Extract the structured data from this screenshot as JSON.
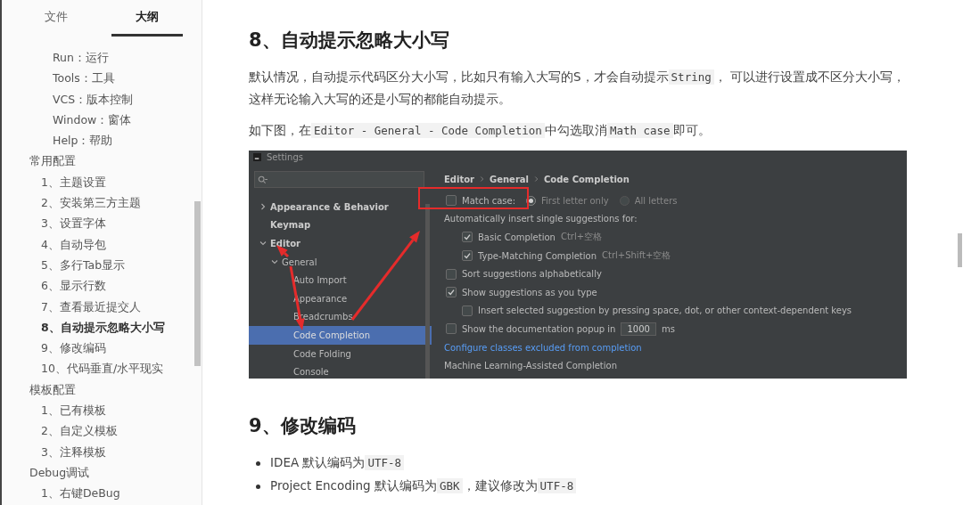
{
  "sidebar": {
    "tabs": [
      {
        "label": "文件",
        "selected": false
      },
      {
        "label": "大纲",
        "selected": true
      }
    ],
    "outline": [
      {
        "children": [
          {
            "children": [
              {
                "label": "Run：运行",
                "selected": false
              },
              {
                "label": "Tools：工具",
                "selected": false
              },
              {
                "label": "VCS：版本控制",
                "selected": false
              },
              {
                "label": "Window：窗体",
                "selected": false
              },
              {
                "label": "Help：帮助",
                "selected": false
              }
            ]
          }
        ]
      },
      {
        "label": "常用配置",
        "selected": false,
        "children": [
          {
            "label": "1、主题设置",
            "selected": false
          },
          {
            "label": "2、安装第三方主题",
            "selected": false
          },
          {
            "label": "3、设置字体",
            "selected": false
          },
          {
            "label": "4、自动导包",
            "selected": false
          },
          {
            "label": "5、多行Tab显示",
            "selected": false
          },
          {
            "label": "6、显示行数",
            "selected": false
          },
          {
            "label": "7、查看最近提交人",
            "selected": false
          },
          {
            "label": "8、自动提示忽略大小写",
            "selected": true
          },
          {
            "label": "9、修改编码",
            "selected": false
          },
          {
            "label": "10、代码垂直/水平现实",
            "selected": false
          }
        ]
      },
      {
        "label": "模板配置",
        "selected": false,
        "children": [
          {
            "label": "1、已有模板",
            "selected": false
          },
          {
            "label": "2、自定义模板",
            "selected": false
          },
          {
            "label": "3、注释模板",
            "selected": false
          }
        ]
      },
      {
        "label": "Debug调试",
        "selected": false,
        "children": [
          {
            "label": "1、右键DeBug",
            "selected": false
          }
        ]
      }
    ]
  },
  "article": [
    {
      "kind": "heading",
      "text": "8、自动提示忽略大小写"
    },
    {
      "kind": "paragraph",
      "segments": [
        {
          "kind": "text",
          "text": "默认情况，自动提示代码区分大小写，比如只有输入大写的S，才会自动提示"
        },
        {
          "kind": "code",
          "text": "String"
        },
        {
          "kind": "text",
          "text": "， 可以进行设置成不区分大小写，这样无论输入大写的还是小写的都能自动提示。"
        }
      ]
    },
    {
      "kind": "paragraph",
      "segments": [
        {
          "kind": "text",
          "text": "如下图，在"
        },
        {
          "kind": "code",
          "text": "Editor - General - Code Completion"
        },
        {
          "kind": "text",
          "text": "中勾选取消"
        },
        {
          "kind": "code",
          "text": "Math case"
        },
        {
          "kind": "text",
          "text": "即可。"
        }
      ]
    },
    {
      "kind": "screenshot",
      "title": "Settings",
      "tree": [
        {
          "label": "Appearance & Behavior",
          "expanded": false,
          "selected": false
        },
        {
          "label": "Keymap",
          "selected": false
        },
        {
          "label": "Editor",
          "expanded": true,
          "selected": false,
          "children": [
            {
              "label": "General",
              "expanded": true,
              "selected": false,
              "children": [
                {
                  "label": "Auto Import",
                  "selected": false
                },
                {
                  "label": "Appearance",
                  "selected": false
                },
                {
                  "label": "Breadcrumbs",
                  "selected": false
                },
                {
                  "label": "Code Completion",
                  "selected": true
                },
                {
                  "label": "Code Folding",
                  "selected": false
                },
                {
                  "label": "Console",
                  "selected": false
                }
              ]
            }
          ]
        }
      ],
      "breadcrumbs": [
        "Editor",
        "General",
        "Code Completion"
      ],
      "options": [
        {
          "kind": "checkbox",
          "label": "Match case:",
          "checked": false,
          "radios": [
            {
              "label": "First letter only",
              "selected": true
            },
            {
              "label": "All letters",
              "selected": false
            }
          ]
        },
        {
          "kind": "heading",
          "label": "Automatically insert single suggestions for:",
          "children": [
            {
              "kind": "checkbox",
              "label": "Basic Completion",
              "checked": true,
              "shortcut": "Ctrl+空格"
            },
            {
              "kind": "checkbox",
              "label": "Type-Matching Completion",
              "checked": true,
              "shortcut": "Ctrl+Shift+空格"
            }
          ]
        },
        {
          "kind": "checkbox",
          "label": "Sort suggestions alphabetically",
          "checked": false
        },
        {
          "kind": "checkbox",
          "label": "Show suggestions as you type",
          "checked": true,
          "children": [
            {
              "kind": "checkbox",
              "label": "Insert selected suggestion by pressing space, dot, or other context-dependent keys",
              "checked": false
            }
          ]
        },
        {
          "kind": "number",
          "label": "Show the documentation popup in",
          "checked": false,
          "value": "1000",
          "unit": "ms"
        },
        {
          "kind": "link",
          "label": "Configure classes excluded from completion"
        },
        {
          "kind": "section",
          "label": "Machine Learning-Assisted Completion"
        }
      ]
    },
    {
      "kind": "heading",
      "text": "9、修改编码"
    },
    {
      "kind": "bullets",
      "items": [
        {
          "segments": [
            {
              "kind": "text",
              "text": "IDEA 默认编码为"
            },
            {
              "kind": "code",
              "text": "UTF-8"
            }
          ]
        },
        {
          "segments": [
            {
              "kind": "text",
              "text": "Project Encoding 默认编码为"
            },
            {
              "kind": "code",
              "text": "GBK"
            },
            {
              "kind": "text",
              "text": "，建议修改为"
            },
            {
              "kind": "code",
              "text": "UTF-8"
            }
          ]
        }
      ]
    }
  ]
}
